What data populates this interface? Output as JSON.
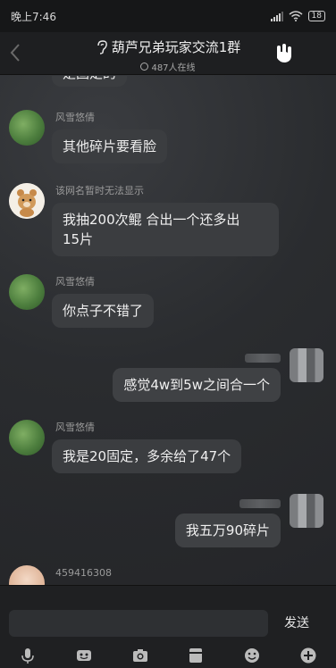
{
  "status": {
    "time": "晚上7:46",
    "battery": "18"
  },
  "header": {
    "title": "葫芦兄弟玩家交流1群",
    "online": "487人在线"
  },
  "messages": [
    {
      "side": "left",
      "sender": "",
      "text": "是固定的"
    },
    {
      "side": "left",
      "sender": "风雪悠倩",
      "text": "其他碎片要看脸"
    },
    {
      "side": "left",
      "sender": "该网名暂时无法显示",
      "text_line1": "我抽200次鲲  合出一个还多出",
      "text_line2": "15片"
    },
    {
      "side": "left",
      "sender": "风雪悠倩",
      "text": "你点子不错了"
    },
    {
      "side": "right",
      "text": "感觉4w到5w之间合一个"
    },
    {
      "side": "left",
      "sender": "风雪悠倩",
      "text": "我是20固定，多余给了47个"
    },
    {
      "side": "right",
      "text": "我五万90碎片"
    },
    {
      "side": "left",
      "sender": "459416308",
      "text": ""
    }
  ],
  "input": {
    "placeholder": "",
    "send_label": "发送"
  },
  "toolbar": [
    "microphone-icon",
    "emoji-pack-icon",
    "camera-icon",
    "folder-icon",
    "smiley-icon",
    "plus-icon"
  ]
}
